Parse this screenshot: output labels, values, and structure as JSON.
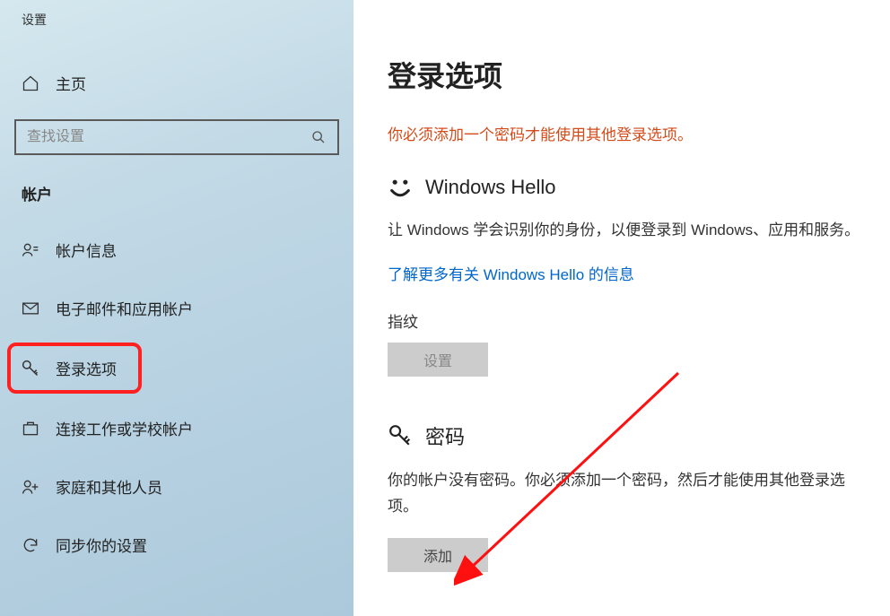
{
  "window": {
    "title": "设置"
  },
  "sidebar": {
    "home_label": "主页",
    "search_placeholder": "查找设置",
    "category_label": "帐户",
    "items": [
      {
        "label": "帐户信息"
      },
      {
        "label": "电子邮件和应用帐户"
      },
      {
        "label": "登录选项"
      },
      {
        "label": "连接工作或学校帐户"
      },
      {
        "label": "家庭和其他人员"
      },
      {
        "label": "同步你的设置"
      }
    ]
  },
  "main": {
    "page_title": "登录选项",
    "warning": "你必须添加一个密码才能使用其他登录选项。",
    "hello": {
      "title": "Windows Hello",
      "description": "让 Windows 学会识别你的身份，以便登录到 Windows、应用和服务。",
      "link": "了解更多有关 Windows Hello 的信息",
      "fingerprint_label": "指纹",
      "setup_button": "设置"
    },
    "password": {
      "title": "密码",
      "description": "你的帐户没有密码。你必须添加一个密码，然后才能使用其他登录选项。",
      "add_button": "添加"
    }
  }
}
